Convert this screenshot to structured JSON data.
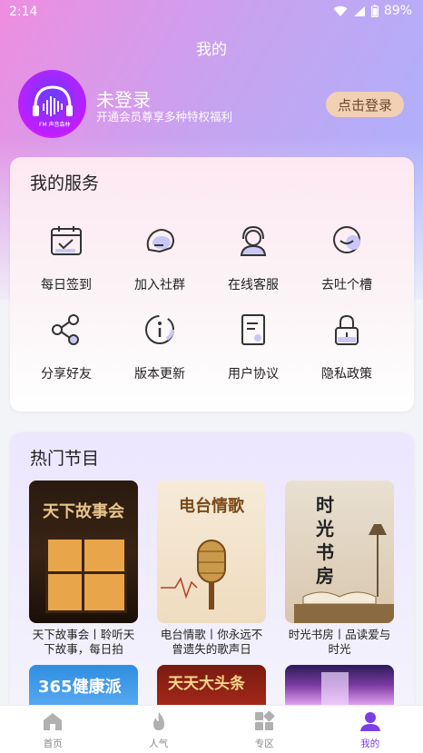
{
  "status": {
    "time": "2:14",
    "battery": "89%"
  },
  "header": {
    "title": "我的"
  },
  "user": {
    "name": "未登录",
    "subtitle": "开通会员尊享多种特权福利",
    "login_label": "点击登录",
    "avatar_logo_text": "FM 声音森林"
  },
  "services": {
    "title": "我的服务",
    "items": [
      {
        "label": "每日签到",
        "icon": "calendar-check-icon"
      },
      {
        "label": "加入社群",
        "icon": "chat-bubble-icon"
      },
      {
        "label": "在线客服",
        "icon": "headset-icon"
      },
      {
        "label": "去吐个槽",
        "icon": "smile-chat-icon"
      },
      {
        "label": "分享好友",
        "icon": "share-icon"
      },
      {
        "label": "版本更新",
        "icon": "info-icon"
      },
      {
        "label": "用户协议",
        "icon": "document-icon"
      },
      {
        "label": "隐私政策",
        "icon": "lock-icon"
      }
    ]
  },
  "hot": {
    "title": "热门节目",
    "programs": [
      {
        "caption": "天下故事会丨聆听天下故事，每日拍",
        "cover_text": "天下故事会"
      },
      {
        "caption": "电台情歌丨你永远不曾遗失的歌声日",
        "cover_text": "电台情歌"
      },
      {
        "caption": "时光书房丨品读爱与时光",
        "cover_text": "时光书房"
      }
    ],
    "programs_row2": [
      {
        "cover_text": "365健康派"
      },
      {
        "cover_text": "天天大头条"
      },
      {
        "cover_text": ""
      }
    ]
  },
  "tabs": [
    {
      "label": "首页",
      "icon": "home-icon"
    },
    {
      "label": "人气",
      "icon": "fire-icon"
    },
    {
      "label": "专区",
      "icon": "grid-icon"
    },
    {
      "label": "我的",
      "icon": "person-icon",
      "active": true
    }
  ],
  "colors": {
    "accent": "#7b3fe4",
    "login_bg": "#f2d0b4"
  }
}
